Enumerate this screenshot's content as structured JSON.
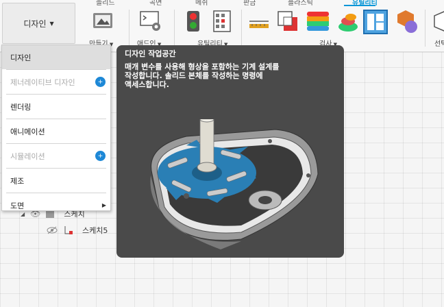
{
  "toolbar": {
    "tabs": [
      "솔리드",
      "곡면",
      "메쉬",
      "판금",
      "플라스틱",
      "유틸리티"
    ],
    "active_tab": "유틸리티",
    "workspace_label": "디자인",
    "groups": {
      "make_label": "만들기",
      "addins_label": "애드인",
      "utility_label": "유틸리티",
      "inspect_label": "검사",
      "select_label": "선택"
    },
    "accent_color": "#0696d7"
  },
  "menu": {
    "items": [
      {
        "label": "디자인",
        "state": "selected"
      },
      {
        "label": "제너레이티브 디자인",
        "state": "disabled",
        "badge": "plus-icon"
      },
      {
        "label": "렌더링",
        "state": "normal"
      },
      {
        "label": "애니메이션",
        "state": "normal"
      },
      {
        "label": "시뮬레이션",
        "state": "disabled",
        "badge": "plus-icon"
      },
      {
        "label": "제조",
        "state": "normal"
      },
      {
        "label": "도면",
        "state": "normal",
        "submenu": true
      }
    ]
  },
  "browser": {
    "rows": [
      {
        "label": "스케치"
      },
      {
        "label": "스케치5"
      }
    ]
  },
  "tooltip": {
    "title": "디자인 작업공간",
    "description": "매개 변수를 사용해 형상을 포함하는 기계 설계를\n작성합니다. 솔리드 본체를 작성하는 명령에\n액세스합니다."
  }
}
